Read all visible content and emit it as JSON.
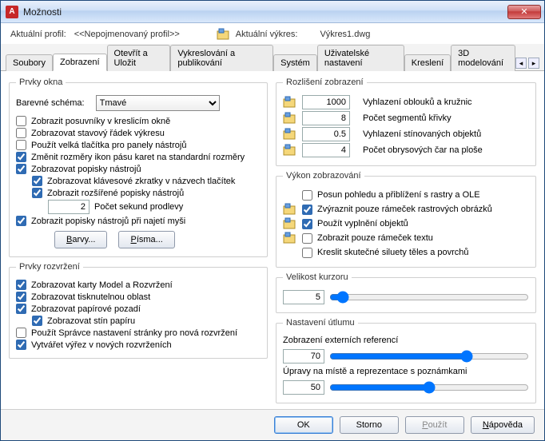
{
  "window": {
    "title": "Možnosti"
  },
  "header": {
    "profile_label": "Aktuální profil:",
    "profile_value": "<<Nepojmenovaný profil>>",
    "drawing_label": "Aktuální výkres:",
    "drawing_value": "Výkres1.dwg"
  },
  "tabs": [
    "Soubory",
    "Zobrazení",
    "Otevřít a Uložit",
    "Vykreslování a publikování",
    "Systém",
    "Uživatelské nastavení",
    "Kreslení",
    "3D modelování"
  ],
  "tab_active_index": 1,
  "left": {
    "grp_window": "Prvky okna",
    "colorscheme_label": "Barevné schéma:",
    "colorscheme_value": "Tmavé",
    "chk_scrollbars": {
      "checked": false,
      "label": "Zobrazit posuvníky v kreslicím okně"
    },
    "chk_statusbar": {
      "checked": false,
      "label": "Zobrazovat stavový řádek výkresu"
    },
    "chk_largebuttons": {
      "checked": false,
      "label": "Použít velká tlačítka pro panely nástrojů"
    },
    "chk_resizeicons": {
      "checked": true,
      "label": "Změnit rozměry ikon pásu karet na standardní rozměry"
    },
    "chk_tooltips": {
      "checked": true,
      "label": "Zobrazovat popisky nástrojů"
    },
    "chk_shortcuts": {
      "checked": true,
      "label": "Zobrazovat klávesové zkratky v názvech tlačítek"
    },
    "chk_exttips": {
      "checked": true,
      "label": "Zobrazit rozšířené popisky nástrojů"
    },
    "delay_value": "2",
    "delay_label": "Počet sekund prodlevy",
    "chk_hovertips": {
      "checked": true,
      "label": "Zobrazit popisky nástrojů při najetí myši"
    },
    "btn_colors": "Barvy...",
    "btn_fonts": "Písma...",
    "grp_layout": "Prvky rozvržení",
    "chk_modeltabs": {
      "checked": true,
      "label": "Zobrazovat karty Model a Rozvržení"
    },
    "chk_printable": {
      "checked": true,
      "label": "Zobrazovat tisknutelnou oblast"
    },
    "chk_paperbg": {
      "checked": true,
      "label": "Zobrazovat papírové pozadí"
    },
    "chk_papershadow": {
      "checked": true,
      "label": "Zobrazovat stín papíru"
    },
    "chk_pagesetup": {
      "checked": false,
      "label": "Použít Správce nastavení stránky pro nová rozvržení"
    },
    "chk_viewport": {
      "checked": true,
      "label": "Vytvářet výřez v nových rozvrženích"
    }
  },
  "right": {
    "grp_res": "Rozlišení zobrazení",
    "res_arc": {
      "value": "1000",
      "label": "Vyhlazení oblouků a kružnic"
    },
    "res_seg": {
      "value": "8",
      "label": "Počet segmentů křivky"
    },
    "res_smooth": {
      "value": "0.5",
      "label": "Vyhlazení stínovaných objektů"
    },
    "res_contour": {
      "value": "4",
      "label": "Počet obrysových čar na ploše"
    },
    "grp_perf": "Výkon zobrazování",
    "chk_panzoom": {
      "checked": false,
      "label": "Posun pohledu a přiblížení s rastry a OLE"
    },
    "chk_rasterframe": {
      "checked": true,
      "label": "Zvýraznit pouze rámeček rastrových obrázků"
    },
    "chk_fill": {
      "checked": true,
      "label": "Použít vyplnění objektů"
    },
    "chk_textframe": {
      "checked": false,
      "label": "Zobrazit pouze rámeček textu"
    },
    "chk_silhouette": {
      "checked": false,
      "label": "Kreslit skutečné siluety těles a povrchů"
    },
    "grp_cursor": "Velikost kurzoru",
    "cursor_value": "5",
    "grp_fade": "Nastavení útlumu",
    "fade_xref_label": "Zobrazení externích referencí",
    "fade_xref_value": "70",
    "fade_inplace_label": "Úpravy na místě a reprezentace s poznámkami",
    "fade_inplace_value": "50"
  },
  "footer": {
    "ok": "OK",
    "cancel": "Storno",
    "apply": "Použít",
    "help": "Nápověda"
  }
}
